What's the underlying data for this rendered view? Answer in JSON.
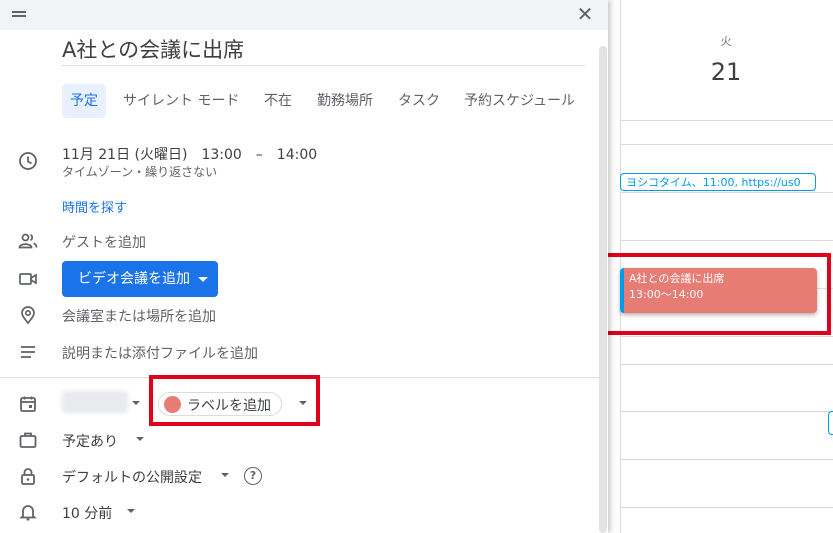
{
  "dialog": {
    "title": "A社との会議に出席",
    "tabs": [
      {
        "label": "予定",
        "active": true
      },
      {
        "label": "サイレント モード"
      },
      {
        "label": "不在"
      },
      {
        "label": "勤務場所"
      },
      {
        "label": "タスク"
      },
      {
        "label": "予約スケジュール"
      }
    ],
    "datetime": "11月 21日 (火曜日)　13:00　–　14:00",
    "timezone_repeat": "タイムゾーン・繰り返さない",
    "find_time": "時間を探す",
    "add_guests": "ゲストを追加",
    "video_button": "ビデオ会議を追加",
    "location": "会議室または場所を追加",
    "description": "説明または添付ファイルを追加",
    "label_button": "ラベルを追加",
    "label_color": "#e67c73",
    "busy_status": "予定あり",
    "visibility": "デフォルトの公開設定",
    "help_symbol": "?",
    "notification": "10 分前",
    "close_symbol": "✕"
  },
  "calendar": {
    "day_of_week": "火",
    "day_number": "21",
    "events": [
      {
        "title": "ヨシコタイム、11:00, https://us0"
      },
      {
        "title": "A社との会議に出席",
        "time": "13:00〜14:00",
        "color": "#e67c73"
      }
    ]
  },
  "colors": {
    "accent": "#1a73e8",
    "highlight_box": "#e0001b",
    "event_border": "#039be5"
  }
}
